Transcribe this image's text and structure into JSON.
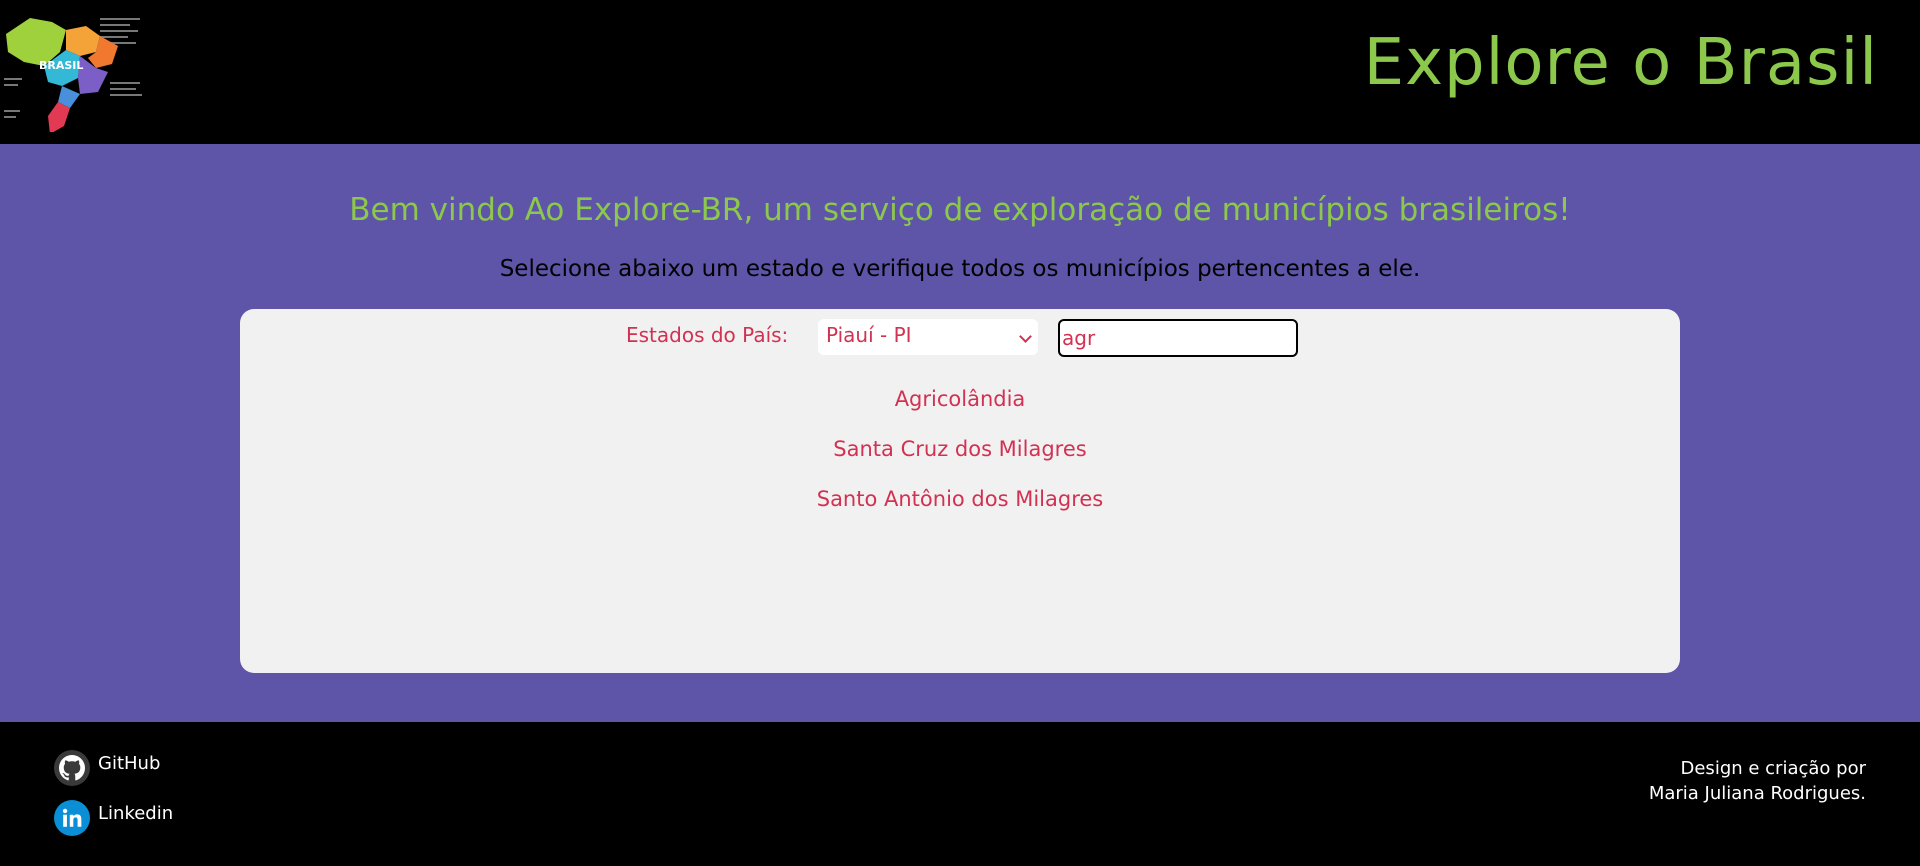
{
  "header": {
    "logo_text": "BRASIL",
    "title": "Explore o Brasil"
  },
  "main": {
    "welcome": "Bem vindo Ao Explore-BR, um serviço de exploração de municípios brasileiros!",
    "subtitle": "Selecione abaixo um estado e verifique todos os municípios pertencentes a ele.",
    "state_label": "Estados do País:",
    "selected_state": "Piauí - PI",
    "search_value": "agr",
    "results": [
      "Agricolândia",
      "Santa Cruz dos Milagres",
      "Santo Antônio dos Milagres"
    ]
  },
  "footer": {
    "github_label": "GitHub",
    "linkedin_label": "Linkedin",
    "credit": "Design e criação por Maria Juliana Rodrigues."
  },
  "colors": {
    "accent_green": "#8cc84b",
    "main_purple": "#5e54a8",
    "text_red": "#d23152",
    "panel_gray": "#f1f1f1"
  }
}
